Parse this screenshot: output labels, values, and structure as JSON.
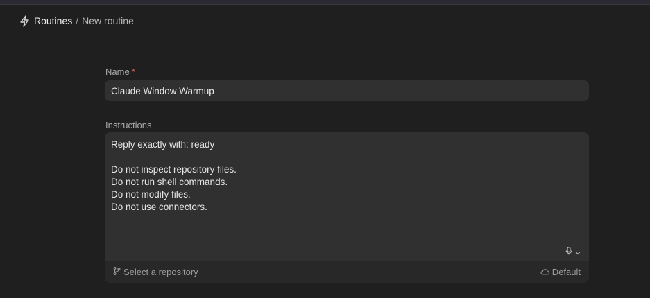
{
  "breadcrumb": {
    "root_icon": "bolt-icon",
    "root": "Routines",
    "separator": "/",
    "current": "New routine"
  },
  "form": {
    "name_label": "Name",
    "required_marker": "*",
    "name_value": "Claude Window Warmup",
    "instructions_label": "Instructions",
    "instructions_value": "Reply exactly with: ready\n\nDo not inspect repository files.\nDo not run shell commands.\nDo not modify files.\nDo not use connectors.",
    "repository_button": "Select a repository",
    "environment_button": "Default"
  },
  "colors": {
    "background": "#1f1f1f",
    "field": "#303030",
    "required": "#e06c5f"
  }
}
